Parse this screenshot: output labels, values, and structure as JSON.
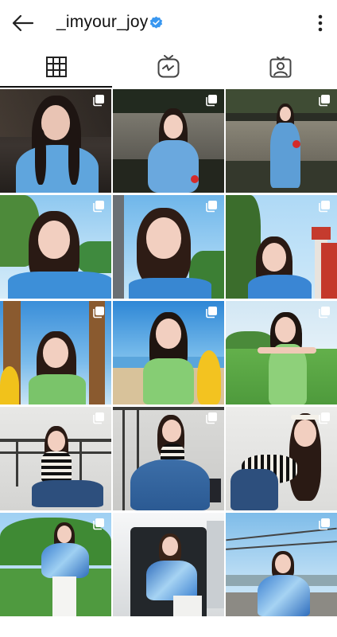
{
  "header": {
    "username": "_imyour_joy",
    "back_icon": "arrow-left-icon",
    "verified_icon": "verified-badge-icon",
    "more_icon": "more-vertical-icon",
    "verified_color": "#3897f0"
  },
  "tabs": [
    {
      "name": "posts-grid",
      "icon": "grid-icon",
      "active": true
    },
    {
      "name": "igtv",
      "icon": "igtv-icon",
      "active": false
    },
    {
      "name": "tagged",
      "icon": "tagged-person-icon",
      "active": false
    }
  ],
  "posts": [
    {
      "multi": true,
      "theme": "night-blue-dress-portrait"
    },
    {
      "multi": true,
      "theme": "night-blue-dress-wall"
    },
    {
      "multi": true,
      "theme": "night-blue-dress-fullbody"
    },
    {
      "multi": true,
      "theme": "sky-offshoulder-closeup"
    },
    {
      "multi": true,
      "theme": "sky-offshoulder-smile"
    },
    {
      "multi": true,
      "theme": "lighthouse-blue-top"
    },
    {
      "multi": true,
      "theme": "palm-beach-green-top"
    },
    {
      "multi": true,
      "theme": "beach-surfboard-green-top"
    },
    {
      "multi": true,
      "theme": "field-green-dress"
    },
    {
      "multi": true,
      "theme": "studio-striped-top-sitting"
    },
    {
      "multi": true,
      "theme": "studio-jeans-crouch"
    },
    {
      "multi": true,
      "theme": "studio-striped-top-lean"
    },
    {
      "multi": true,
      "theme": "garden-tie-dye-shirt"
    },
    {
      "multi": false,
      "theme": "van-door-tie-dye"
    },
    {
      "multi": true,
      "theme": "road-tie-dye-skyline"
    }
  ],
  "colors": {
    "text": "#111111",
    "icon": "#333333",
    "active_tab_bar": "#111111"
  }
}
